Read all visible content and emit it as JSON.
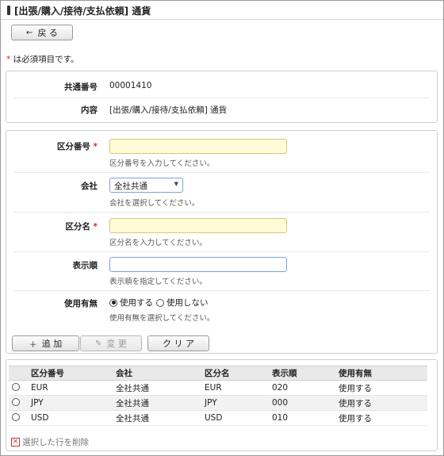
{
  "header": {
    "title": "[出張/購入/接待/支払依頼] 通貨",
    "back_label": "戻 る"
  },
  "required_note": "は必須項目です。",
  "info": {
    "common_no_label": "共通番号",
    "common_no_value": "00001410",
    "content_label": "内容",
    "content_value": "[出張/購入/接待/支払依頼] 通貨"
  },
  "form": {
    "category_no": {
      "label": "区分番号",
      "value": "",
      "hint": "区分番号を入力してください。"
    },
    "company": {
      "label": "会社",
      "selected": "全社共通",
      "hint": "会社を選択してください。"
    },
    "category_name": {
      "label": "区分名",
      "value": "",
      "hint": "区分名を入力してください。"
    },
    "display_order": {
      "label": "表示順",
      "value": "",
      "hint": "表示順を指定してください。"
    },
    "usage": {
      "label": "使用有無",
      "option_use": "使用する",
      "option_nouse": "使用しない",
      "selected": "使用する",
      "hint": "使用有無を選択してください。"
    }
  },
  "actions": {
    "add_label": "追 加",
    "edit_label": "変 更",
    "clear_label": "ク リ ア"
  },
  "table": {
    "columns": [
      "区分番号",
      "会社",
      "区分名",
      "表示順",
      "使用有無"
    ],
    "rows": [
      [
        "EUR",
        "全社共通",
        "EUR",
        "020",
        "使用する"
      ],
      [
        "JPY",
        "全社共通",
        "JPY",
        "000",
        "使用する"
      ],
      [
        "USD",
        "全社共通",
        "USD",
        "010",
        "使用する"
      ]
    ]
  },
  "delete_label": "選択した行を削除"
}
